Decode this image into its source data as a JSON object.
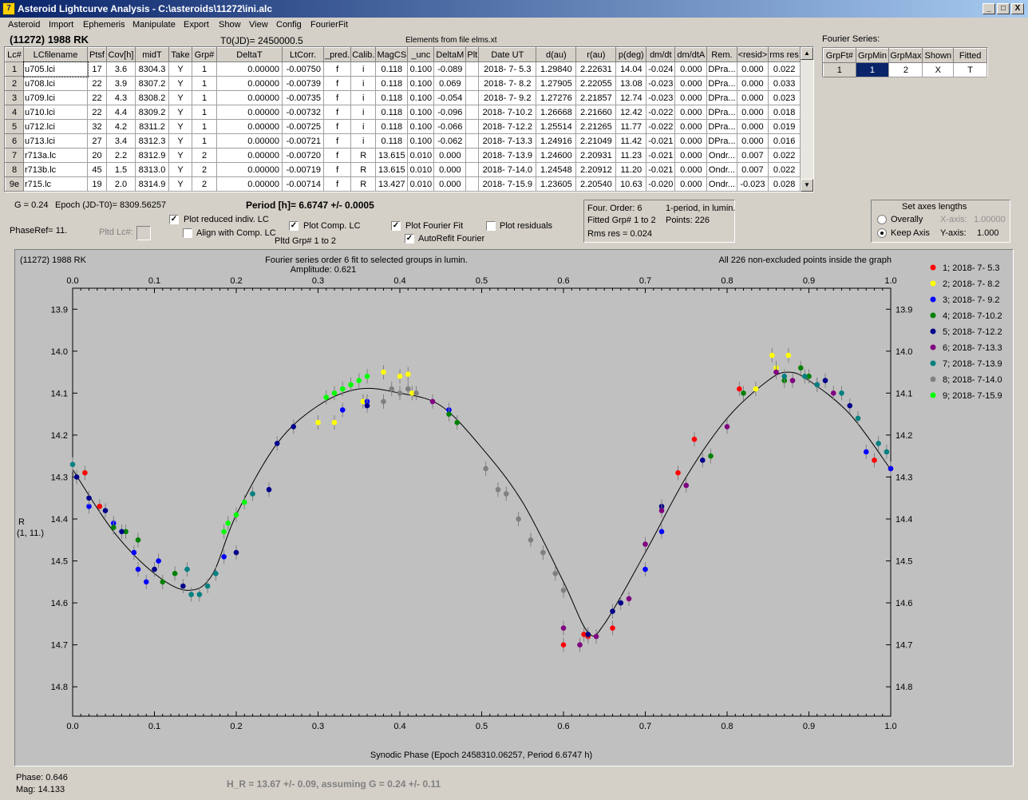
{
  "window": {
    "title": "Asteroid Lightcurve Analysis - C:\\asteroids\\11272\\ini.alc",
    "icon": "app-icon",
    "minimize": "_",
    "maximize": "□",
    "close": "X"
  },
  "menu": [
    "Asteroid",
    "Import",
    "Ephemeris",
    "Manipulate",
    "Export",
    "Show",
    "View",
    "Config",
    "FourierFit"
  ],
  "header": {
    "object": "(11272) 1988 RK",
    "t0": "T0(JD)= 2450000.5",
    "elements": "Elements from file elms.xt"
  },
  "table": {
    "columns": [
      "Lc#",
      "LCfilename",
      "Ptsf",
      "Cov[h]",
      "midT",
      "Take",
      "Grp#",
      "DeltaT",
      "LtCorr.",
      "_pred.",
      "Calib.",
      "MagCS",
      "_unc",
      "DeltaM",
      "Plt",
      "Date UT",
      "d(au)",
      "r(au)",
      "p(deg)",
      "dm/dt",
      "dm/dtA",
      "Rem.",
      "<resid>",
      "rms res"
    ],
    "rows": [
      [
        "1",
        "u705.lci",
        "17",
        "3.6",
        "8304.3",
        "Y",
        "1",
        "0.00000",
        "-0.00750",
        "f",
        "i",
        "0.118",
        "0.100",
        "-0.089",
        "",
        "2018- 7- 5.3",
        "1.29840",
        "2.22631",
        "14.04",
        "-0.024",
        "0.000",
        "DPra...",
        "0.000",
        "0.022"
      ],
      [
        "2",
        "u708.lci",
        "22",
        "3.9",
        "8307.2",
        "Y",
        "1",
        "0.00000",
        "-0.00739",
        "f",
        "i",
        "0.118",
        "0.100",
        "0.069",
        "",
        "2018- 7- 8.2",
        "1.27905",
        "2.22055",
        "13.08",
        "-0.023",
        "0.000",
        "DPra...",
        "0.000",
        "0.033"
      ],
      [
        "3",
        "u709.lci",
        "22",
        "4.3",
        "8308.2",
        "Y",
        "1",
        "0.00000",
        "-0.00735",
        "f",
        "i",
        "0.118",
        "0.100",
        "-0.054",
        "",
        "2018- 7- 9.2",
        "1.27276",
        "2.21857",
        "12.74",
        "-0.023",
        "0.000",
        "DPra...",
        "0.000",
        "0.023"
      ],
      [
        "4",
        "u710.lci",
        "22",
        "4.4",
        "8309.2",
        "Y",
        "1",
        "0.00000",
        "-0.00732",
        "f",
        "i",
        "0.118",
        "0.100",
        "-0.096",
        "",
        "2018- 7-10.2",
        "1.26668",
        "2.21660",
        "12.42",
        "-0.022",
        "0.000",
        "DPra...",
        "0.000",
        "0.018"
      ],
      [
        "5",
        "u712.lci",
        "32",
        "4.2",
        "8311.2",
        "Y",
        "1",
        "0.00000",
        "-0.00725",
        "f",
        "i",
        "0.118",
        "0.100",
        "-0.066",
        "",
        "2018- 7-12.2",
        "1.25514",
        "2.21265",
        "11.77",
        "-0.022",
        "0.000",
        "DPra...",
        "0.000",
        "0.019"
      ],
      [
        "6",
        "u713.lci",
        "27",
        "3.4",
        "8312.3",
        "Y",
        "1",
        "0.00000",
        "-0.00721",
        "f",
        "i",
        "0.118",
        "0.100",
        "-0.062",
        "",
        "2018- 7-13.3",
        "1.24916",
        "2.21049",
        "11.42",
        "-0.021",
        "0.000",
        "DPra...",
        "0.000",
        "0.016"
      ],
      [
        "7",
        "r713a.lc",
        "20",
        "2.2",
        "8312.9",
        "Y",
        "2",
        "0.00000",
        "-0.00720",
        "f",
        "R",
        "13.615",
        "0.010",
        "0.000",
        "",
        "2018- 7-13.9",
        "1.24600",
        "2.20931",
        "11.23",
        "-0.021",
        "0.000",
        "Ondr...",
        "0.007",
        "0.022"
      ],
      [
        "8",
        "r713b.lc",
        "45",
        "1.5",
        "8313.0",
        "Y",
        "2",
        "0.00000",
        "-0.00719",
        "f",
        "R",
        "13.615",
        "0.010",
        "0.000",
        "",
        "2018- 7-14.0",
        "1.24548",
        "2.20912",
        "11.20",
        "-0.021",
        "0.000",
        "Ondr...",
        "0.007",
        "0.022"
      ],
      [
        "9e",
        "r715.lc",
        "19",
        "2.0",
        "8314.9",
        "Y",
        "2",
        "0.00000",
        "-0.00714",
        "f",
        "R",
        "13.427",
        "0.010",
        "0.000",
        "",
        "2018- 7-15.9",
        "1.23605",
        "2.20540",
        "10.63",
        "-0.020",
        "0.000",
        "Ondr...",
        "-0.023",
        "0.028"
      ]
    ]
  },
  "fourier_table": {
    "title": "Fourier Series:",
    "columns": [
      "GrpFt#",
      "GrpMin",
      "GrpMax",
      "Shown",
      "Fitted"
    ],
    "row": [
      "1",
      "1",
      "2",
      "X",
      "T"
    ]
  },
  "controls": {
    "g": "G = 0.24",
    "epoch": "Epoch (JD-T0)= 8309.56257",
    "period": "Period [h]= 6.6747 +/- 0.0005",
    "phaseref": "PhaseRef= 11.",
    "pltd_lc": "Pltd Lc#:",
    "plot_reduced": "Plot reduced indiv. LC",
    "align_comp": "Align with Comp. LC",
    "plot_comp": "Plot Comp. LC",
    "pltd_grp": "Pltd Grp#  1   to   2",
    "plot_fourier": "Plot Fourier Fit",
    "autorefit": "AutoRefit Fourier",
    "plot_residuals": "Plot residuals",
    "check": "✓"
  },
  "info_box": {
    "order": "Four. Order:  6",
    "fitted": "Fitted Grp# 1 to 2",
    "rms": "Rms res     = 0.024",
    "mode": "1-period, in lumin.",
    "points": "Points: 226"
  },
  "axes_box": {
    "title": "Set axes lengths",
    "overally": "Overally",
    "keep": "Keep Axis",
    "x_label": "X-axis:",
    "x_val": "1.00000",
    "y_label": "Y-axis:",
    "y_val": "1.000"
  },
  "status": {
    "phase": "Phase:  0.646",
    "mag": "Mag:    14.133",
    "hr": "H_R = 13.67 +/- 0.09, assuming G = 0.24 +/- 0.11"
  },
  "chart_data": {
    "type": "scatter",
    "title": "Fourier series order 6 fit to selected groups in lumin.",
    "subtitle": "Amplitude: 0.621",
    "object_label": "(11272) 1988 RK",
    "note": "All 226 non-excluded points inside the graph",
    "xlabel": "Synodic Phase (Epoch 2458310.06257, Period 6.6747 h)",
    "ylabel": [
      "R",
      "(1, 11.)"
    ],
    "xlim": [
      0,
      1
    ],
    "ylim": [
      13.85,
      14.87
    ],
    "y_inverted": true,
    "xticks": [
      "0.0",
      "0.1",
      "0.2",
      "0.3",
      "0.4",
      "0.5",
      "0.6",
      "0.7",
      "0.8",
      "0.9",
      "1.0"
    ],
    "yticks": [
      "13.9",
      "14.0",
      "14.1",
      "14.2",
      "14.3",
      "14.4",
      "14.5",
      "14.6",
      "14.7",
      "14.8"
    ],
    "fit_curve": [
      [
        0,
        14.282
      ],
      [
        0.05,
        14.43
      ],
      [
        0.1,
        14.53
      ],
      [
        0.14,
        14.57
      ],
      [
        0.17,
        14.535
      ],
      [
        0.2,
        14.39
      ],
      [
        0.25,
        14.22
      ],
      [
        0.3,
        14.13
      ],
      [
        0.35,
        14.09
      ],
      [
        0.4,
        14.1
      ],
      [
        0.45,
        14.13
      ],
      [
        0.5,
        14.23
      ],
      [
        0.55,
        14.36
      ],
      [
        0.6,
        14.55
      ],
      [
        0.63,
        14.67
      ],
      [
        0.65,
        14.65
      ],
      [
        0.7,
        14.48
      ],
      [
        0.75,
        14.3
      ],
      [
        0.8,
        14.16
      ],
      [
        0.85,
        14.07
      ],
      [
        0.875,
        14.05
      ],
      [
        0.9,
        14.07
      ],
      [
        0.95,
        14.15
      ],
      [
        1,
        14.282
      ]
    ],
    "series": [
      {
        "name": "1; 2018- 7- 5.3",
        "color": "#ff0000",
        "points": [
          [
            0.015,
            14.29
          ],
          [
            0.033,
            14.37
          ],
          [
            0.6,
            14.7
          ],
          [
            0.625,
            14.675
          ],
          [
            0.63,
            14.68
          ],
          [
            0.66,
            14.66
          ],
          [
            0.74,
            14.29
          ],
          [
            0.76,
            14.21
          ],
          [
            0.815,
            14.09
          ],
          [
            0.98,
            14.26
          ],
          [
            1.0,
            14.28
          ]
        ]
      },
      {
        "name": "2; 2018- 7- 8.2",
        "color": "#ffff00",
        "points": [
          [
            0.3,
            14.17
          ],
          [
            0.32,
            14.17
          ],
          [
            0.355,
            14.12
          ],
          [
            0.38,
            14.05
          ],
          [
            0.4,
            14.06
          ],
          [
            0.41,
            14.055
          ],
          [
            0.415,
            14.1
          ],
          [
            0.835,
            14.09
          ],
          [
            0.855,
            14.01
          ],
          [
            0.875,
            14.01
          ],
          [
            0.86,
            14.04
          ]
        ]
      },
      {
        "name": "3; 2018- 7- 9.2",
        "color": "#0000ff",
        "points": [
          [
            0.02,
            14.37
          ],
          [
            0.05,
            14.41
          ],
          [
            0.075,
            14.48
          ],
          [
            0.08,
            14.52
          ],
          [
            0.09,
            14.55
          ],
          [
            0.105,
            14.5
          ],
          [
            0.185,
            14.49
          ],
          [
            0.33,
            14.14
          ],
          [
            0.36,
            14.12
          ],
          [
            0.46,
            14.14
          ],
          [
            0.7,
            14.52
          ],
          [
            0.72,
            14.43
          ],
          [
            0.97,
            14.24
          ],
          [
            1.0,
            14.28
          ]
        ]
      },
      {
        "name": "4; 2018- 7-10.2",
        "color": "#008000",
        "points": [
          [
            0.05,
            14.42
          ],
          [
            0.065,
            14.43
          ],
          [
            0.08,
            14.45
          ],
          [
            0.11,
            14.55
          ],
          [
            0.125,
            14.53
          ],
          [
            0.46,
            14.15
          ],
          [
            0.47,
            14.17
          ],
          [
            0.78,
            14.25
          ],
          [
            0.82,
            14.1
          ],
          [
            0.87,
            14.07
          ],
          [
            0.89,
            14.04
          ],
          [
            0.9,
            14.06
          ]
        ]
      },
      {
        "name": "5; 2018- 7-12.2",
        "color": "#00008b",
        "points": [
          [
            0.005,
            14.3
          ],
          [
            0.02,
            14.35
          ],
          [
            0.04,
            14.38
          ],
          [
            0.06,
            14.43
          ],
          [
            0.1,
            14.52
          ],
          [
            0.135,
            14.56
          ],
          [
            0.2,
            14.48
          ],
          [
            0.24,
            14.33
          ],
          [
            0.25,
            14.22
          ],
          [
            0.27,
            14.18
          ],
          [
            0.36,
            14.13
          ],
          [
            0.63,
            14.675
          ],
          [
            0.66,
            14.62
          ],
          [
            0.67,
            14.6
          ],
          [
            0.72,
            14.37
          ],
          [
            0.77,
            14.26
          ],
          [
            0.92,
            14.07
          ],
          [
            0.95,
            14.13
          ]
        ]
      },
      {
        "name": "6; 2018- 7-13.3",
        "color": "#800080",
        "points": [
          [
            0.44,
            14.12
          ],
          [
            0.6,
            14.66
          ],
          [
            0.62,
            14.7
          ],
          [
            0.64,
            14.68
          ],
          [
            0.68,
            14.59
          ],
          [
            0.7,
            14.46
          ],
          [
            0.72,
            14.38
          ],
          [
            0.75,
            14.32
          ],
          [
            0.8,
            14.18
          ],
          [
            0.86,
            14.05
          ],
          [
            0.88,
            14.07
          ],
          [
            0.91,
            14.08
          ],
          [
            0.93,
            14.1
          ]
        ]
      },
      {
        "name": "7; 2018- 7-13.9",
        "color": "#008080",
        "points": [
          [
            0.0,
            14.27
          ],
          [
            0.14,
            14.52
          ],
          [
            0.145,
            14.58
          ],
          [
            0.155,
            14.58
          ],
          [
            0.165,
            14.56
          ],
          [
            0.175,
            14.53
          ],
          [
            0.22,
            14.34
          ],
          [
            0.87,
            14.06
          ],
          [
            0.895,
            14.06
          ],
          [
            0.91,
            14.08
          ],
          [
            0.94,
            14.1
          ],
          [
            0.96,
            14.16
          ],
          [
            0.985,
            14.22
          ],
          [
            0.995,
            14.24
          ]
        ]
      },
      {
        "name": "8; 2018- 7-14.0",
        "color": "#808080",
        "points": [
          [
            0.39,
            14.09
          ],
          [
            0.4,
            14.1
          ],
          [
            0.41,
            14.09
          ],
          [
            0.42,
            14.1
          ],
          [
            0.505,
            14.28
          ],
          [
            0.52,
            14.33
          ],
          [
            0.53,
            14.34
          ],
          [
            0.545,
            14.4
          ],
          [
            0.56,
            14.45
          ],
          [
            0.575,
            14.48
          ],
          [
            0.59,
            14.53
          ],
          [
            0.6,
            14.57
          ],
          [
            0.38,
            14.12
          ]
        ]
      },
      {
        "name": "9; 2018- 7-15.9",
        "color": "#00ff00",
        "points": [
          [
            0.185,
            14.43
          ],
          [
            0.19,
            14.41
          ],
          [
            0.2,
            14.39
          ],
          [
            0.21,
            14.36
          ],
          [
            0.31,
            14.11
          ],
          [
            0.32,
            14.1
          ],
          [
            0.33,
            14.09
          ],
          [
            0.35,
            14.07
          ],
          [
            0.36,
            14.06
          ],
          [
            0.34,
            14.08
          ]
        ]
      }
    ]
  }
}
